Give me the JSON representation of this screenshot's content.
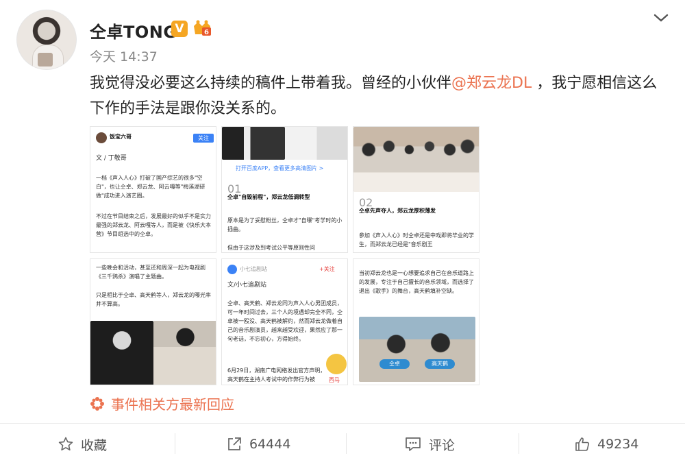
{
  "post": {
    "user_name": "仝卓TONG",
    "verified_badge": "V",
    "level_badge": "6",
    "time": "今天 14:37",
    "text_before": "我觉得没必要这么持续的稿件上带着我。曾经的小伙伴",
    "mention": "@郑云龙DL",
    "text_after": " ，我宁愿相信这么下作的手法是跟你没关系的。"
  },
  "thumbnails": {
    "t1": {
      "source": "饭宝六哥",
      "follow": "关注",
      "author": "文 / 丁敬哥",
      "p1": "一档《声入人心》打破了国产综艺的很多\"空白\"，也让仝卓、郑云龙、阿云嘎等\"梅溪湖研做\"成功进入演艺圈。",
      "p2": "不过在节目结束之后，发展最好的似乎不是实力最强的郑云龙、阿云嘎等人，而是被《快乐大本营》节目组选中的仝卓。"
    },
    "t2": {
      "app_link": "打开百度APP，查看更多高清图片 >",
      "num": "01",
      "heading": "仝卓\"自毁前程\"，郑云龙低调转型",
      "p1": "原本是为了妥慰粉丝，仝卓才\"自曝\"考学时的小插曲。",
      "p2": "但由于这涉及到考试公平等原则性问"
    },
    "t3": {
      "num": "02",
      "heading": "仝卓先声夺人，郑云龙厚积薄发",
      "p1": "参加《声入人心》时仝卓还是中戏即将毕业的学生，而郑云龙已经是\"音乐剧王"
    },
    "t4": {
      "p1": "一些晚会和活动，甚至还和周深一起为电视剧《三千鸦杀》演唱了主题曲。",
      "p2": "只是相比于仝卓、高天鹤等人，郑云龙的曝光率并不算高。"
    },
    "t5": {
      "source": "小七追剧站",
      "follow_badge": "+关注",
      "title": "文/小七追剧站",
      "p1": "仝卓、高天鹤、郑云龙同为声入人心男团成员，可一年时间过去，三个人的境遇却完全不同，仝卓被一殴没、高天鹤被解约，然而郑云龙做着自己的音乐剧演员，越来越受欢迎，果然应了那一句老话，不忘初心，方得始终。",
      "p2": "6月29日，湖南广电网络发出官方声明，高天鹤在主持人考试中的作弊行为被",
      "tag": "西马"
    },
    "t6": {
      "p1": "当初郑云龙也是一心想要追求自己在音乐道路上的发展，专注于自己擅长的音乐领域，而选择了退出《歌手》的舞台，高天鹤填补空缺。",
      "caption_left": "仝卓",
      "caption_right": "高天鹤"
    }
  },
  "response": {
    "label": "事件相关方最新回应",
    "icon": "flower-icon"
  },
  "actions": {
    "favorite": "收藏",
    "forward_count": "64444",
    "comment": "评论",
    "like_count": "49234"
  },
  "colors": {
    "accent": "#eb7350",
    "badge": "#f5a623"
  }
}
